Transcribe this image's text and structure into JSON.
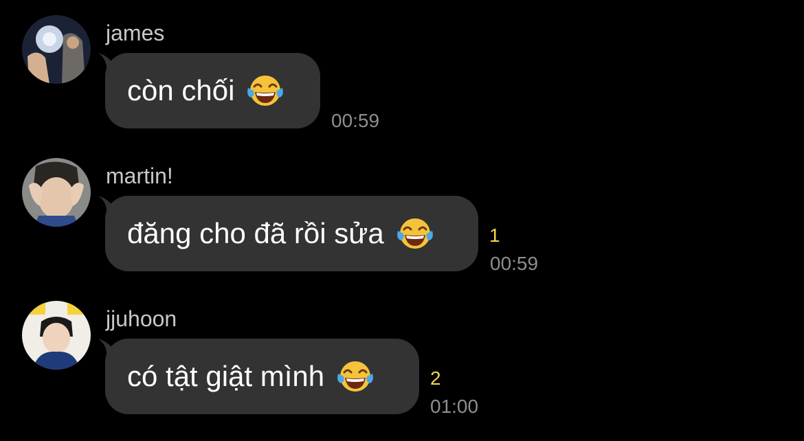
{
  "messages": [
    {
      "sender": "james",
      "text": "còn chối",
      "emoji_icon": "face-with-tears-of-joy-icon",
      "unread": "",
      "time": "00:59"
    },
    {
      "sender": "martin!",
      "text": "đăng cho đã rồi sửa",
      "emoji_icon": "face-with-tears-of-joy-icon",
      "unread": "1",
      "time": "00:59"
    },
    {
      "sender": "jjuhoon",
      "text": "có tật giật mình",
      "emoji_icon": "face-with-tears-of-joy-icon",
      "unread": "2",
      "time": "01:00"
    }
  ],
  "colors": {
    "background": "#000000",
    "bubble": "#333333",
    "unread": "#f2d64b",
    "time": "#8e8e8e"
  }
}
